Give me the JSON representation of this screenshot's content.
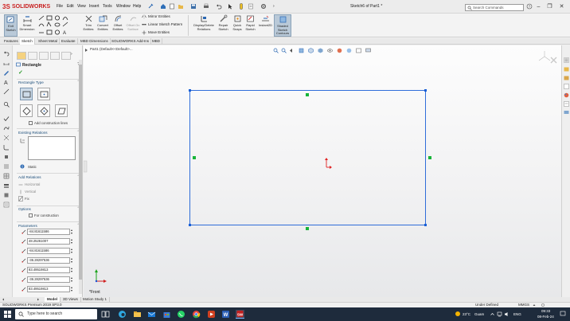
{
  "app": {
    "name": "SOLIDWORKS",
    "document_title": "Sketch6 of Part1 *"
  },
  "menus": [
    "File",
    "Edit",
    "View",
    "Insert",
    "Tools",
    "Window",
    "Help"
  ],
  "search": {
    "placeholder": "Search Commands"
  },
  "command_manager": {
    "big_tools": [
      {
        "label": "Exit Sketch",
        "icon": "exit-sketch-icon",
        "active": true
      },
      {
        "label": "Smart Dimension",
        "icon": "smart-dimension-icon"
      },
      {
        "label": "Trim Entities",
        "icon": "trim-icon"
      },
      {
        "label": "Convert Entities",
        "icon": "convert-icon"
      },
      {
        "label": "Offset Entities",
        "icon": "offset-icon"
      },
      {
        "label": "Offset On Surface",
        "icon": "offset-surface-icon",
        "disabled": true
      },
      {
        "label": "Display/Delete Relations",
        "icon": "relations-icon"
      },
      {
        "label": "Repair Sketch",
        "icon": "repair-icon"
      },
      {
        "label": "Quick Snaps",
        "icon": "snaps-icon"
      },
      {
        "label": "Rapid Sketch",
        "icon": "rapid-sketch-icon"
      },
      {
        "label": "Instant2D",
        "icon": "instant2d-icon"
      },
      {
        "label": "Shaded Sketch Contours",
        "icon": "shaded-contours-icon",
        "active": true
      }
    ],
    "row_tools": [
      "Mirror Entities",
      "Linear Sketch Pattern",
      "Move Entities"
    ]
  },
  "tabs": [
    "Features",
    "Sketch",
    "Sheet Metal",
    "Evaluate",
    "MBD Dimensions",
    "SOLIDWORKS Add-Ins",
    "MBD"
  ],
  "active_tab": "Sketch",
  "property_manager": {
    "title": "Rectangle",
    "help": "?",
    "ok": "✓",
    "sections": {
      "rect_type": "Rectangle Type",
      "construction": "Add construction lines",
      "existing": "Existing Relations",
      "static": "Static",
      "add_rel": "Add Relations",
      "horizontal": "Horizontal",
      "vertical": "Vertical",
      "fix": "Fix",
      "options": "Options",
      "for_construction": "For construction",
      "parameters": "Parameters"
    },
    "parameters": [
      "-84.81611586",
      "48.25261007",
      "-84.81611586",
      "-36.28297536",
      "83.49519813",
      "-36.28297536",
      "83.49519813"
    ]
  },
  "graphics": {
    "tree_flyout": "Part1  (Default<<Default>...",
    "view_label": "*Front"
  },
  "bottom_tabs": [
    "Model",
    "3D Views",
    "Motion Study 1"
  ],
  "status": {
    "left": "SOLIDWORKS Premium 2019 SP3.0",
    "state": "Under Defined",
    "units": "MMGS"
  },
  "taskbar": {
    "search_placeholder": "Type here to search",
    "weather": "23°C",
    "weather_text": "Guam",
    "lang": "ENG",
    "time": "09:33",
    "date": "08-Feb-24"
  },
  "colors": {
    "sketch_line": "#1a5fd6",
    "endpoint": "#18b43a",
    "origin": "#e02020"
  }
}
